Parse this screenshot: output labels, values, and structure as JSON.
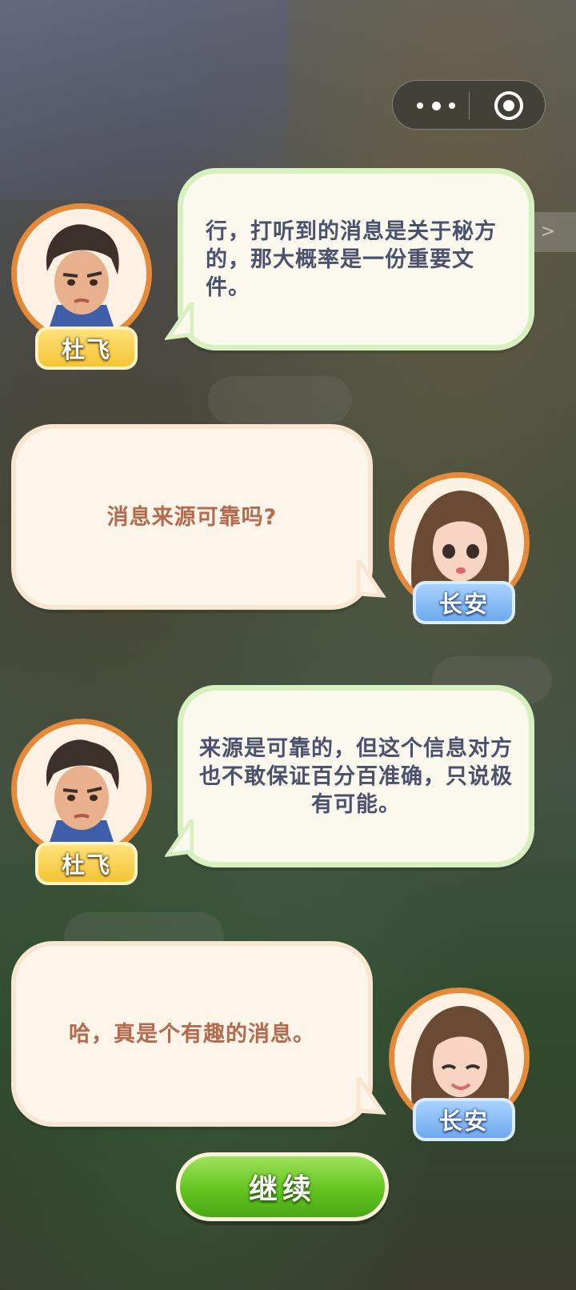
{
  "dialogue": [
    {
      "speaker": "杜飞",
      "text": "行，打听到的消息是关于秘方的，那大概率是一份重要文件。"
    },
    {
      "speaker": "长安",
      "text": "消息来源可靠吗?"
    },
    {
      "speaker": "杜飞",
      "text": "来源是可靠的，但这个信息对方也不敢保证百分百准确，只说极有可能。"
    },
    {
      "speaker": "长安",
      "text": "哈，真是个有趣的消息。"
    }
  ],
  "continue_label": "继续",
  "skip_label": ">",
  "colors": {
    "male_bubble_border": "#d8efc0",
    "female_bubble_text": "#b46a4c",
    "male_bubble_text": "#4c5170",
    "avatar_ring": "#e48a38",
    "nameplate_yellow": "#f3c436",
    "nameplate_blue": "#6ea8ee",
    "continue_green": "#63c421"
  },
  "icons": [
    "more-icon",
    "target-icon",
    "skip-arrow-icon"
  ]
}
